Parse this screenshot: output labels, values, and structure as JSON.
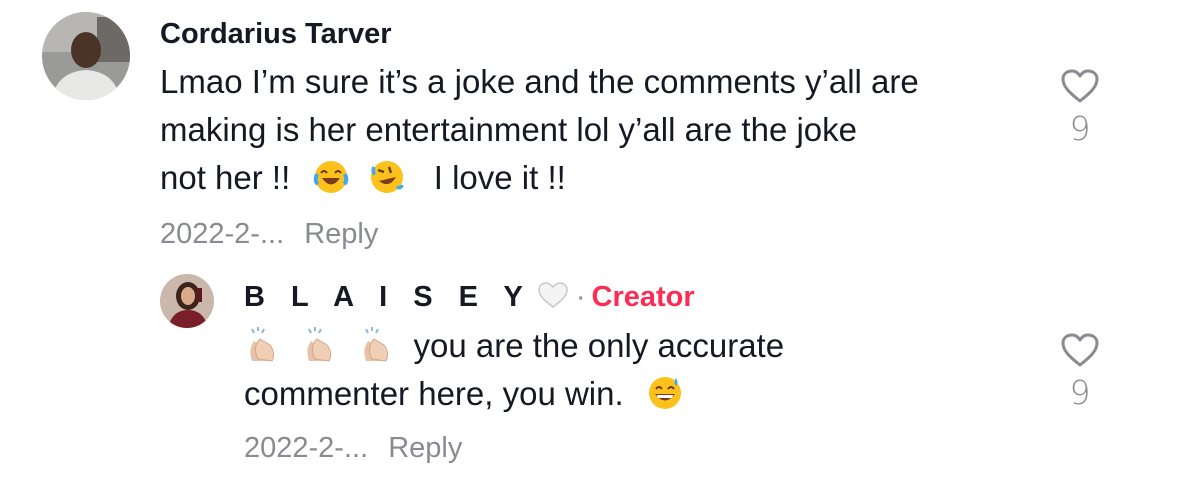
{
  "comment": {
    "author": "Cordarius Tarver",
    "lines": [
      "Lmao I’m sure it’s a joke and the comments y’all are",
      "making is her entertainment lol y’all are the joke",
      "not her !!",
      "I love it !!"
    ],
    "emojis": [
      "face-with-tears-of-joy",
      "rolling-on-floor-laughing"
    ],
    "date": "2022-2-...",
    "reply_label": "Reply",
    "likes": "9"
  },
  "reply": {
    "author": "B L A I S E Y",
    "badge": "Creator",
    "separator": "·",
    "emojis_leading": [
      "clapping-hands",
      "clapping-hands",
      "clapping-hands"
    ],
    "lines": [
      "you are the only accurate",
      "commenter here, you win."
    ],
    "emoji_trailing": "grinning-face-with-sweat",
    "date": "2022-2-...",
    "reply_label": "Reply",
    "likes": "9"
  },
  "colors": {
    "creator": "#fe2c55",
    "meta_gray": "#8a8b91",
    "text": "#161823"
  }
}
